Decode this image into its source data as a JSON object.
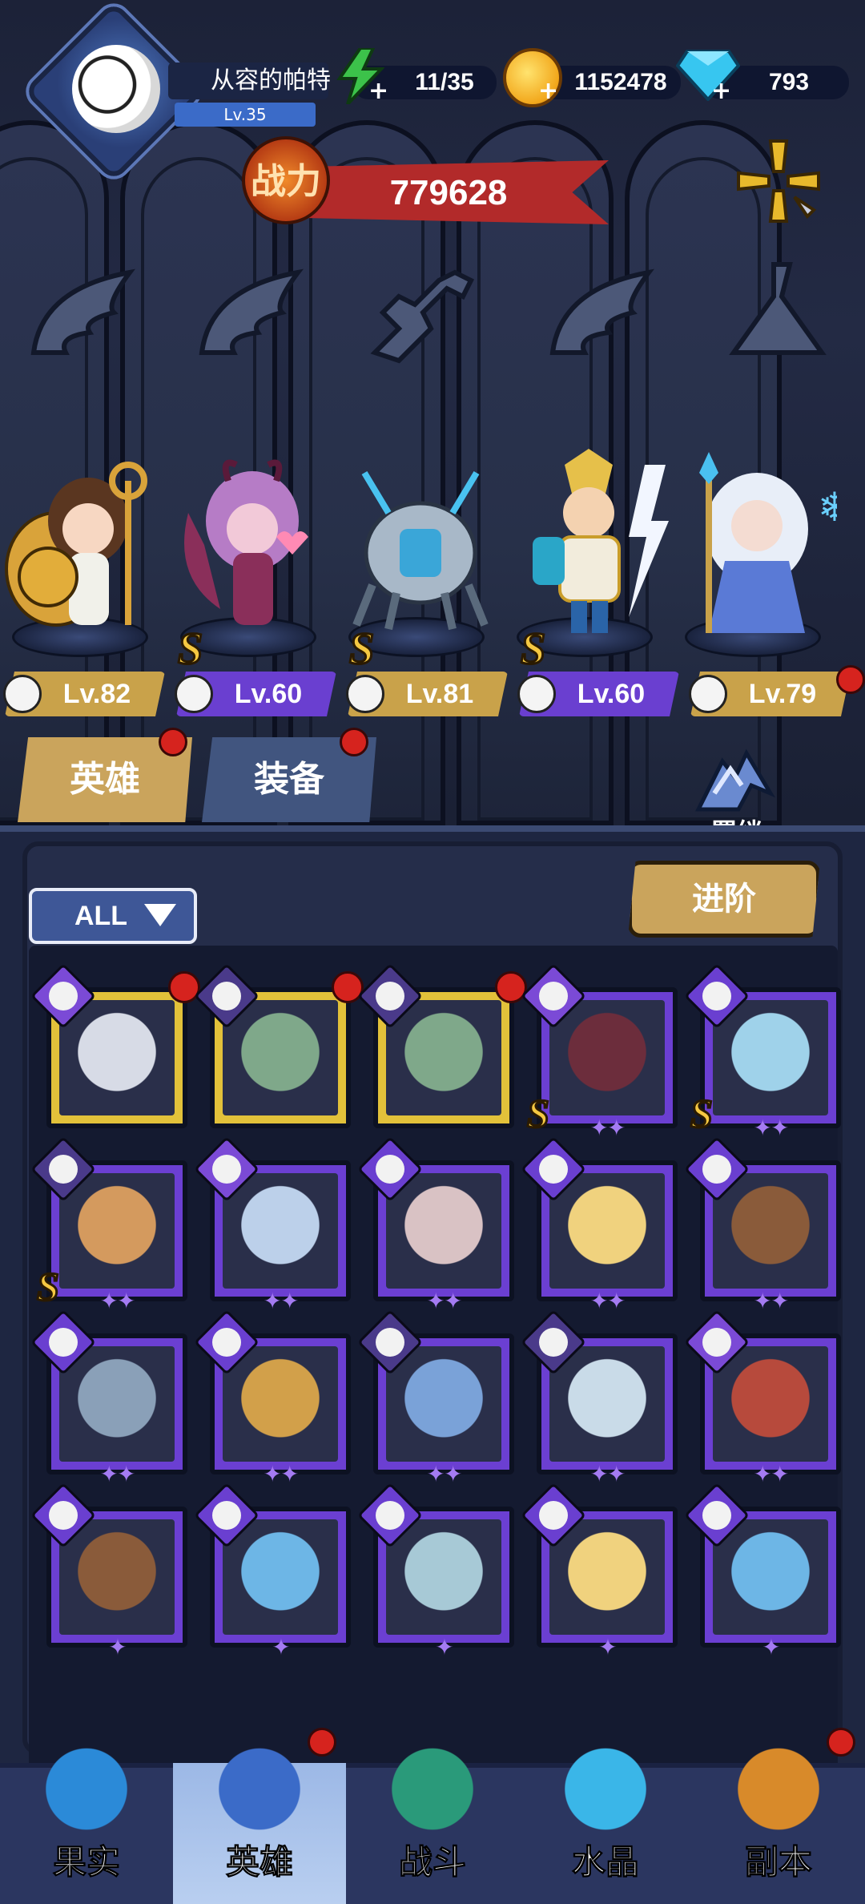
{
  "player": {
    "name": "从容的帕特",
    "level": "Lv.35"
  },
  "resources": {
    "energy": "11/35",
    "gold": "1152478",
    "diamonds": "793"
  },
  "power": {
    "label": "战力",
    "value": "779628"
  },
  "team": [
    {
      "level": "Lv.82",
      "class_icon": "wing-icon",
      "tag_color": "#c9a24a",
      "s_rank": false,
      "red_dot": false
    },
    {
      "level": "Lv.60",
      "class_icon": "wing-icon",
      "tag_color": "#6a3fd0",
      "s_rank": true,
      "red_dot": false
    },
    {
      "level": "Lv.81",
      "class_icon": "wrench-icon",
      "tag_color": "#c9a24a",
      "s_rank": true,
      "red_dot": false
    },
    {
      "level": "Lv.60",
      "class_icon": "wing-icon",
      "tag_color": "#6a3fd0",
      "s_rank": true,
      "red_dot": false
    },
    {
      "level": "Lv.79",
      "class_icon": "potion-icon",
      "tag_color": "#c9a24a",
      "s_rank": false,
      "red_dot": true
    }
  ],
  "tabs": {
    "heroes": "英雄",
    "equipment": "装备",
    "bond": "羁绊"
  },
  "filter": {
    "selected": "ALL"
  },
  "advance_button": "进阶",
  "hero_cards": [
    {
      "frame": "gold",
      "class": "potion",
      "stars": 0,
      "s_rank": false,
      "red_dot": true,
      "color": "#d7dbe6"
    },
    {
      "frame": "gold",
      "class": "claw",
      "stars": 0,
      "s_rank": false,
      "red_dot": true,
      "color": "#7fa88a"
    },
    {
      "frame": "gold",
      "class": "claw",
      "stars": 0,
      "s_rank": false,
      "red_dot": true,
      "color": "#7fa88a"
    },
    {
      "frame": "purple",
      "class": "potion",
      "stars": 2,
      "s_rank": true,
      "red_dot": false,
      "color": "#6c2d3c"
    },
    {
      "frame": "purple",
      "class": "wrench",
      "stars": 2,
      "s_rank": true,
      "red_dot": false,
      "color": "#9fd2ea"
    },
    {
      "frame": "purple",
      "class": "claw",
      "stars": 2,
      "s_rank": true,
      "red_dot": false,
      "color": "#d49a5e"
    },
    {
      "frame": "purple",
      "class": "potion",
      "stars": 2,
      "s_rank": false,
      "red_dot": false,
      "color": "#bcd0ea"
    },
    {
      "frame": "purple",
      "class": "wing",
      "stars": 2,
      "s_rank": false,
      "red_dot": false,
      "color": "#d9c2c4"
    },
    {
      "frame": "purple",
      "class": "wing",
      "stars": 2,
      "s_rank": false,
      "red_dot": false,
      "color": "#f0d27e"
    },
    {
      "frame": "purple",
      "class": "wing",
      "stars": 2,
      "s_rank": false,
      "red_dot": false,
      "color": "#8a5b3a"
    },
    {
      "frame": "purple",
      "class": "wrench",
      "stars": 2,
      "s_rank": false,
      "red_dot": false,
      "color": "#8aa0b8"
    },
    {
      "frame": "purple",
      "class": "wrench",
      "stars": 2,
      "s_rank": false,
      "red_dot": false,
      "color": "#d2a04a"
    },
    {
      "frame": "purple",
      "class": "claw",
      "stars": 2,
      "s_rank": false,
      "red_dot": false,
      "color": "#7aa2d8"
    },
    {
      "frame": "purple",
      "class": "claw",
      "stars": 2,
      "s_rank": false,
      "red_dot": false,
      "color": "#c9dbe8"
    },
    {
      "frame": "purple",
      "class": "potion",
      "stars": 2,
      "s_rank": false,
      "red_dot": false,
      "color": "#b74a3c"
    },
    {
      "frame": "purple",
      "class": "wing",
      "stars": 1,
      "s_rank": false,
      "red_dot": false,
      "color": "#8a5b3a"
    },
    {
      "frame": "purple",
      "class": "wrench",
      "stars": 1,
      "s_rank": false,
      "red_dot": false,
      "color": "#6db6e6"
    },
    {
      "frame": "purple",
      "class": "wrench",
      "stars": 1,
      "s_rank": false,
      "red_dot": false,
      "color": "#a7c9d6"
    },
    {
      "frame": "purple",
      "class": "wing",
      "stars": 1,
      "s_rank": false,
      "red_dot": false,
      "color": "#f0d27e"
    },
    {
      "frame": "purple",
      "class": "wrench",
      "stars": 1,
      "s_rank": false,
      "red_dot": false,
      "color": "#6db6e6"
    }
  ],
  "nav": [
    {
      "label": "果实",
      "icon": "fruit-icon",
      "active": false,
      "red_dot": false
    },
    {
      "label": "英雄",
      "icon": "wizard-hat-icon",
      "active": true,
      "red_dot": true
    },
    {
      "label": "战斗",
      "icon": "sword-icon",
      "active": false,
      "red_dot": false
    },
    {
      "label": "水晶",
      "icon": "crystal-icon",
      "active": false,
      "red_dot": false
    },
    {
      "label": "副本",
      "icon": "portal-icon",
      "active": false,
      "red_dot": true
    }
  ]
}
